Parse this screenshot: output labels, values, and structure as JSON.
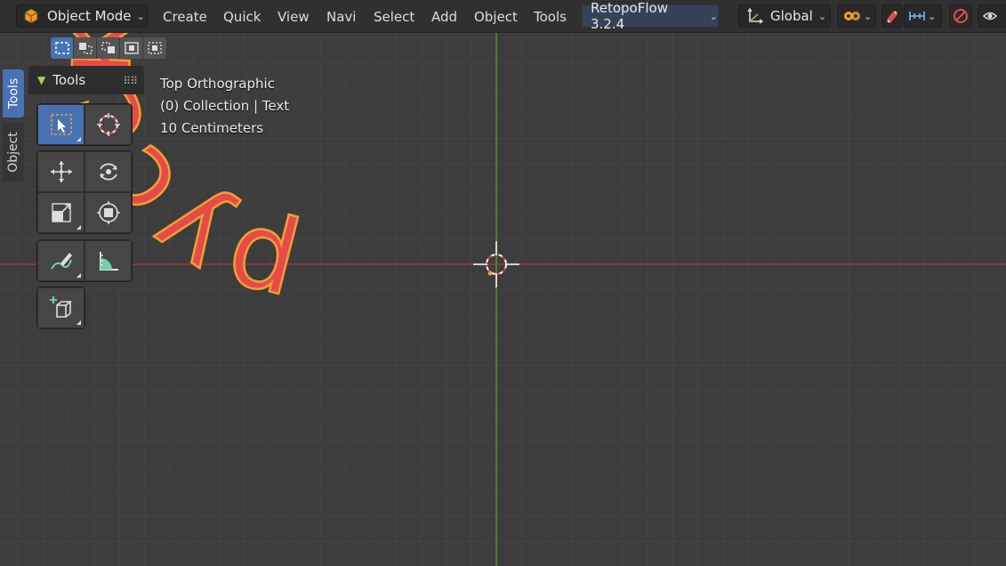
{
  "header": {
    "mode_label": "Object Mode",
    "menus": [
      "Create",
      "Quick",
      "View",
      "Navi",
      "Select",
      "Add",
      "Object",
      "Tools"
    ],
    "addon_label": "RetopoFlow 3.2.4",
    "orientation_label": "Global"
  },
  "side_tabs": {
    "tools": "Tools",
    "object": "Object"
  },
  "tools_panel": {
    "title": "Tools"
  },
  "viewport": {
    "view_name": "Top Orthographic",
    "collection_info": "(0) Collection | Text",
    "grid_scale": "10 Centimeters",
    "text_object": "русский текст",
    "text_color": "#e84a4a",
    "outline_color": "#f0a030"
  },
  "icons": [
    "object-mode-cube-icon",
    "transform-orientation-icon",
    "overlays-icon",
    "snap-magnet-icon",
    "snap-increment-icon",
    "proportional-editing-icon",
    "visibility-icon",
    "select-box-icon",
    "cursor-icon",
    "move-icon",
    "rotate-icon",
    "scale-icon",
    "transform-icon",
    "annotate-icon",
    "measure-icon",
    "add-cube-icon"
  ]
}
